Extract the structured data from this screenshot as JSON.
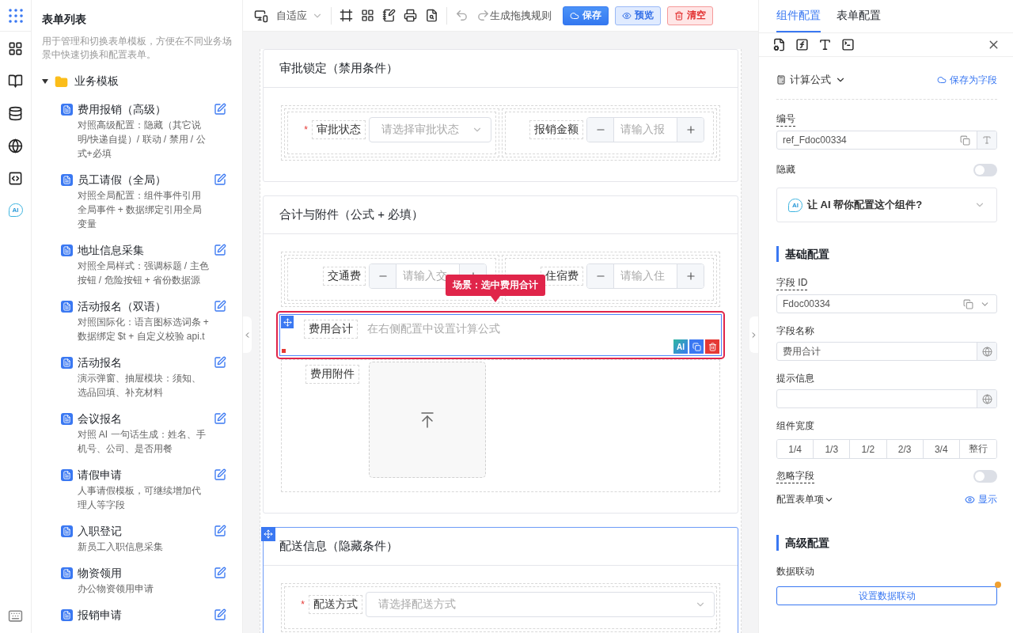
{
  "rail": {
    "ai_label": "AI"
  },
  "left_panel": {
    "title": "表单列表",
    "description": "用于管理和切换表单模板，方便在不同业务场景中快速切换和配置表单。",
    "folder": {
      "label": "业务模板",
      "expanded": true,
      "children": [
        {
          "title": "费用报销（高级）",
          "description": "对照高级配置：隐藏（其它说明/快递自提）/ 联动 / 禁用 / 公式+必填"
        },
        {
          "title": "员工请假（全局）",
          "description": "对照全局配置：组件事件引用全局事件 + 数据绑定引用全局变量"
        },
        {
          "title": "地址信息采集",
          "description": "对照全局样式：强调标题 / 主色按钮 / 危险按钮 + 省份数据源"
        },
        {
          "title": "活动报名（双语）",
          "description": "对照国际化：语言图标选词条 + 数据绑定 $t + 自定义校验 api.t"
        },
        {
          "title": "活动报名",
          "description": "演示弹窗、抽屉模块：须知、选品回填、补充材料"
        },
        {
          "title": "会议报名",
          "description": "对照 AI 一句话生成：姓名、手机号、公司、是否用餐"
        },
        {
          "title": "请假申请",
          "description": "人事请假模板，可继续增加代理人等字段"
        },
        {
          "title": "入职登记",
          "description": "新员工入职信息采集"
        },
        {
          "title": "物资领用",
          "description": "办公物资领用申请"
        },
        {
          "title": "报销申请"
        }
      ]
    }
  },
  "toolbar": {
    "device": "自适应",
    "rule_link": "生成拖拽规则",
    "buttons": [
      {
        "label": "保存",
        "kind": "primary"
      },
      {
        "label": "预览",
        "kind": "secondary"
      },
      {
        "label": "清空",
        "kind": "danger"
      }
    ]
  },
  "canvas": {
    "tooltip": "场景：选中费用合计",
    "sections": [
      {
        "title": "审批锁定（禁用条件）",
        "highlighted": false,
        "rows": [
          {
            "kind": "pair",
            "fields": [
              {
                "kind": "select",
                "label": "审批状态",
                "required_mark": "*",
                "placeholder": "请选择审批状态"
              },
              {
                "kind": "number",
                "label": "报销金额",
                "placeholder": "请输入报"
              }
            ]
          }
        ]
      },
      {
        "title": "合计与附件（公式 + 必填）",
        "highlighted": false,
        "rows": [
          {
            "kind": "pair",
            "fields": [
              {
                "kind": "number",
                "label": "交通费",
                "placeholder": "请输入交"
              },
              {
                "kind": "number",
                "label": "住宿费",
                "placeholder": "请输入住"
              }
            ]
          },
          {
            "kind": "formula",
            "label": "费用合计",
            "placeholder": "在右侧配置中设置计算公式",
            "selected": true,
            "ai_action": "AI"
          },
          {
            "kind": "upload",
            "label": "费用附件"
          }
        ]
      },
      {
        "title": "配送信息（隐藏条件）",
        "highlighted": true,
        "rows": [
          {
            "kind": "single",
            "fields": [
              {
                "kind": "select",
                "label": "配送方式",
                "required_mark": "*",
                "placeholder": "请选择配送方式"
              }
            ]
          }
        ]
      }
    ]
  },
  "right_panel": {
    "tabs": [
      {
        "label": "组件配置",
        "selected": true
      },
      {
        "label": "表单配置",
        "selected": false
      }
    ],
    "component_type": "计算公式",
    "save_as": "保存为字段",
    "ref": {
      "label": "编号",
      "value": "ref_Fdoc00334"
    },
    "hidden": {
      "label": "隐藏",
      "on": false
    },
    "ai_assist": {
      "badge": "AI",
      "label": "让 AI 帮你配置这个组件?",
      "expanded": false
    },
    "basic": {
      "heading": "基础配置",
      "field_id": {
        "label": "字段 ID",
        "value": "Fdoc00334"
      },
      "field_name": {
        "label": "字段名称",
        "value": "费用合计"
      },
      "hint": {
        "label": "提示信息"
      },
      "width": {
        "label": "组件宽度",
        "options": [
          {
            "label": "1/4",
            "selected": false
          },
          {
            "label": "1/3",
            "selected": false
          },
          {
            "label": "1/2",
            "selected": false
          },
          {
            "label": "2/3",
            "selected": false
          },
          {
            "label": "3/4",
            "selected": false
          },
          {
            "label": "整行",
            "selected": false
          }
        ]
      },
      "ignore": {
        "label": "忽略字段",
        "on": false
      },
      "form_items": {
        "label": "配置表单项",
        "toggle": "显示"
      }
    },
    "advanced": {
      "heading": "高级配置",
      "linkage_label": "数据联动",
      "linkage_button": "设置数据联动",
      "linkage_dot": true
    }
  }
}
